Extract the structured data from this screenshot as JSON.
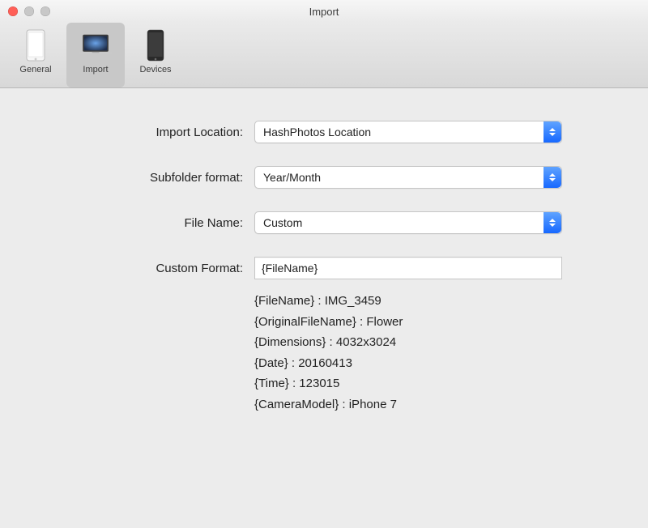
{
  "window": {
    "title": "Import"
  },
  "tabs": {
    "general": "General",
    "import": "Import",
    "devices": "Devices"
  },
  "form": {
    "import_location": {
      "label": "Import Location:",
      "value": "HashPhotos Location"
    },
    "subfolder_format": {
      "label": "Subfolder format:",
      "value": "Year/Month"
    },
    "file_name": {
      "label": "File Name:",
      "value": "Custom"
    },
    "custom_format": {
      "label": "Custom Format:",
      "value": "{FileName}"
    }
  },
  "hints": {
    "l1": "{FileName} : IMG_3459",
    "l2": "{OriginalFileName} : Flower",
    "l3": "{Dimensions} : 4032x3024",
    "l4": "{Date} : 20160413",
    "l5": "{Time} : 123015",
    "l6": "{CameraModel} : iPhone 7"
  }
}
